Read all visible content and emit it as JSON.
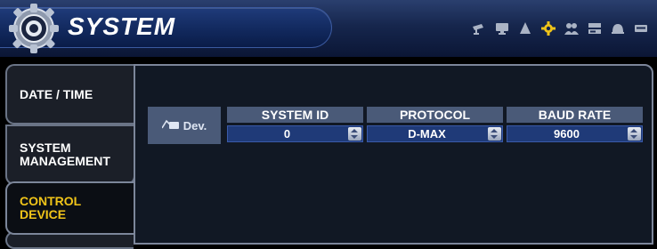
{
  "header": {
    "title": "SYSTEM",
    "icons": [
      "camera-icon",
      "monitor-icon",
      "alarm-icon",
      "gear-icon",
      "users-icon",
      "storage-icon",
      "notification-icon",
      "network-icon"
    ],
    "active_icon": "gear-icon",
    "active_icon_color": "#f0c419"
  },
  "nav": {
    "tabs": [
      {
        "label": "DATE / TIME"
      },
      {
        "label": "SYSTEM\nMANAGEMENT"
      },
      {
        "label": "CONTROL\nDEVICE",
        "active": true
      }
    ]
  },
  "table": {
    "row_label": "Dev.",
    "columns": [
      {
        "header": "SYSTEM ID",
        "value": "0"
      },
      {
        "header": "PROTOCOL",
        "value": "D-MAX"
      },
      {
        "header": "BAUD RATE",
        "value": "9600"
      }
    ]
  },
  "colors": {
    "accent": "#f0c419",
    "header_bg": "#16264d",
    "panel_bg": "#111824",
    "column_header_bg": "#4a5a78",
    "field_bg": "#1f3a78"
  }
}
